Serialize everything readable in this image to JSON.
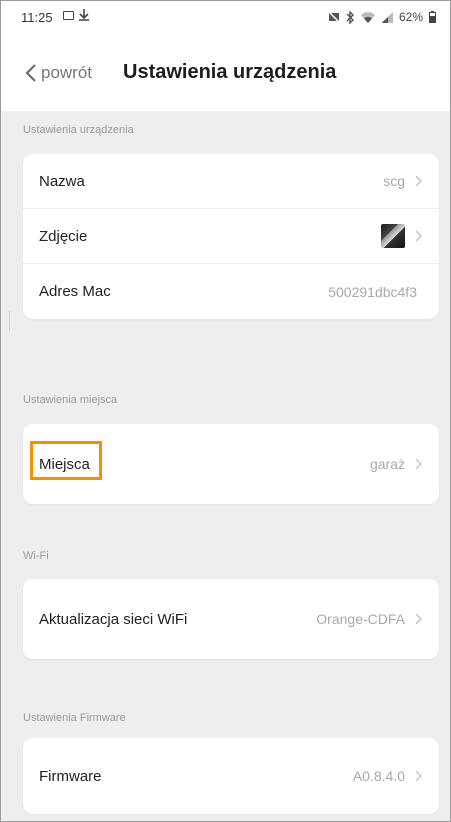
{
  "status_bar": {
    "time": "11:25",
    "battery": "62%",
    "icons": [
      "gallery-icon",
      "download-icon",
      "mute-icon",
      "bluetooth-icon",
      "wifi-icon",
      "signal-icon",
      "battery-icon"
    ]
  },
  "header": {
    "back_label": "powrót",
    "title": "Ustawienia urządzenia"
  },
  "sections": {
    "device": {
      "label": "Ustawienia urządzenia",
      "rows": {
        "name": {
          "label": "Nazwa",
          "value": "scg"
        },
        "photo": {
          "label": "Zdjęcie"
        },
        "mac": {
          "label": "Adres Mac",
          "value": "500291dbc4f3"
        }
      }
    },
    "place": {
      "label": "Ustawienia miejsca",
      "rows": {
        "place": {
          "label": "Miejsca",
          "value": "garaż"
        }
      }
    },
    "wifi": {
      "label": "Wi-Fi",
      "rows": {
        "update": {
          "label": "Aktualizacja sieci WiFi",
          "value": "Orange-CDFA"
        }
      }
    },
    "firmware": {
      "label": "Ustawienia Firmware",
      "rows": {
        "firmware": {
          "label": "Firmware",
          "value": "A0.8.4.0"
        }
      }
    }
  },
  "colors": {
    "highlight": "#f39200",
    "background": "#eeeef0",
    "card": "#ffffff"
  }
}
